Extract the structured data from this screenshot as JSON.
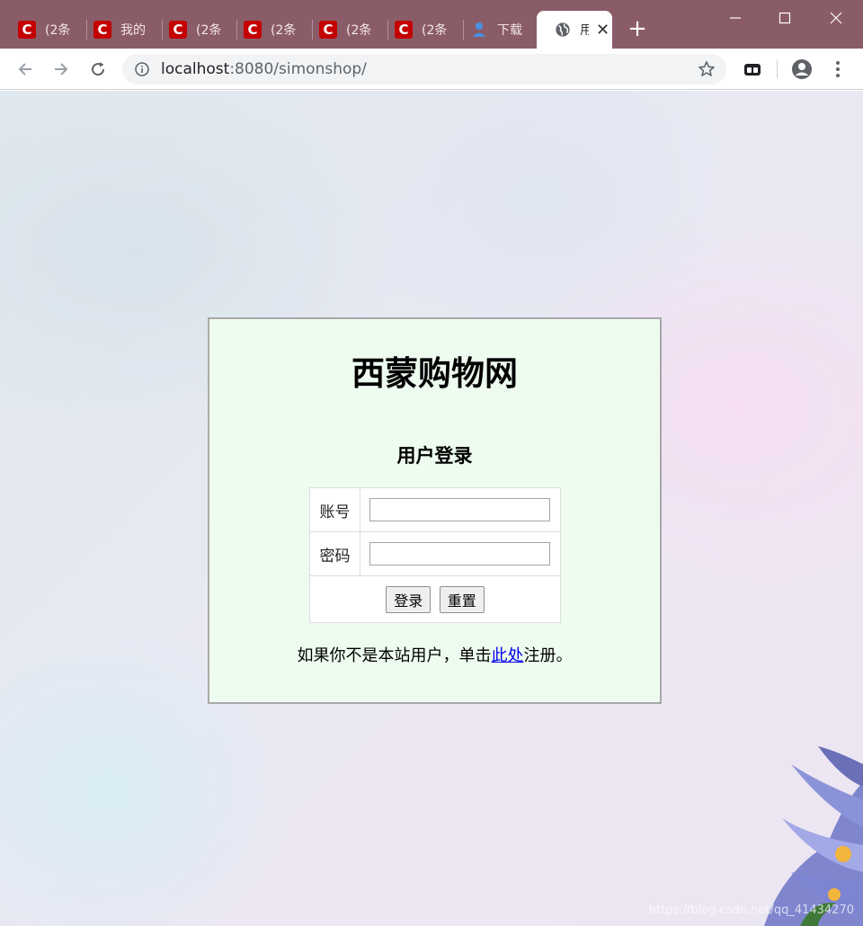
{
  "browser": {
    "tabs": [
      {
        "icon": "csdn-icon",
        "favicon_letter": "C",
        "label": "(2条"
      },
      {
        "icon": "csdn-icon",
        "favicon_letter": "C",
        "label": "我的"
      },
      {
        "icon": "csdn-icon",
        "favicon_letter": "C",
        "label": "(2条"
      },
      {
        "icon": "csdn-icon",
        "favicon_letter": "C",
        "label": "(2条"
      },
      {
        "icon": "csdn-icon",
        "favicon_letter": "C",
        "label": "(2条"
      },
      {
        "icon": "csdn-icon",
        "favicon_letter": "C",
        "label": "(2条"
      },
      {
        "icon": "download-icon",
        "label": "下载"
      },
      {
        "icon": "globe-icon",
        "label": "用",
        "active": true
      }
    ],
    "close_glyph": "✕",
    "new_tab_glyph": "+",
    "address": {
      "host": "localhost",
      "rest": ":8080/simonshop/"
    }
  },
  "page": {
    "site_title": "西蒙购物网",
    "section_title": "用户登录",
    "form": {
      "username_label": "账号",
      "username_value": "",
      "password_label": "密码",
      "password_value": "",
      "login_button": "登录",
      "reset_button": "重置"
    },
    "register": {
      "prefix": "如果你不是本站用户，单击",
      "link": "此处",
      "suffix": "注册。"
    },
    "watermark": "https://blog.csdn.net/qq_41434270"
  },
  "colors": {
    "titlebar": "#8a5c67",
    "csdn_red": "#c40000",
    "login_box_bg": "#eefcef",
    "link": "#0000ee"
  }
}
